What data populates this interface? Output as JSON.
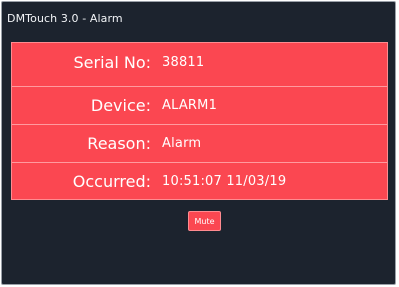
{
  "window": {
    "title": "DMTouch 3.0 - Alarm"
  },
  "alarm": {
    "rows": [
      {
        "label": "Serial No:",
        "value": "38811"
      },
      {
        "label": "Device:",
        "value": "ALARM1"
      },
      {
        "label": "Reason:",
        "value": "Alarm"
      },
      {
        "label": "Occurred:",
        "value": "10:51:07 11/03/19"
      }
    ]
  },
  "actions": {
    "mute_label": "Mute"
  },
  "colors": {
    "background": "#1c232e",
    "alarm_red": "#fb4751",
    "text": "#ffffff"
  }
}
